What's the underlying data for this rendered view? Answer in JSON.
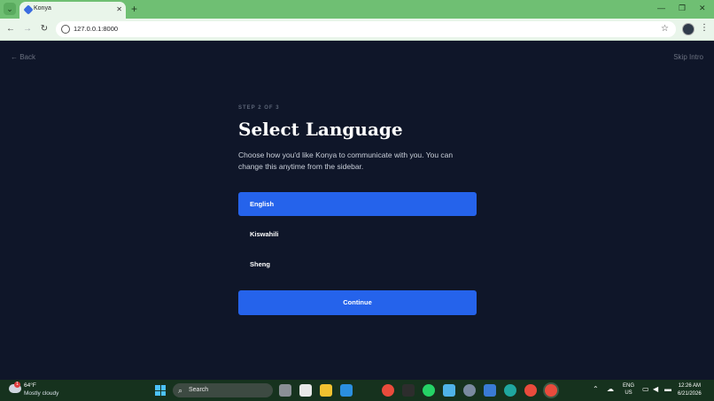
{
  "browser": {
    "tab_title": "Konya",
    "tab_close": "✕",
    "new_tab": "+",
    "url": "127.0.0.1:8000",
    "window_controls": {
      "minimize": "—",
      "maximize": "❐",
      "close": "✕"
    }
  },
  "page": {
    "back_label": "← Back",
    "skip_label": "Skip Intro",
    "step_label": "STEP 2 OF 3",
    "title": "Select Language",
    "description": "Choose how you'd like Konya to communicate with you. You can change this anytime from the sidebar.",
    "options": [
      {
        "label": "English",
        "selected": true
      },
      {
        "label": "Kiswahili",
        "selected": false
      },
      {
        "label": "Sheng",
        "selected": false
      }
    ],
    "continue_label": "Continue"
  },
  "taskbar": {
    "weather_temp": "64°F",
    "weather_desc": "Mostly cloudy",
    "weather_badge": "1",
    "search_label": "Search",
    "lang_line1": "ENG",
    "lang_line2": "US",
    "time": "12:26 AM",
    "date": "6/21/2026"
  },
  "colors": {
    "accent": "#2563eb",
    "page_background": "#0f1629",
    "browser_frame": "#6fbf73"
  }
}
